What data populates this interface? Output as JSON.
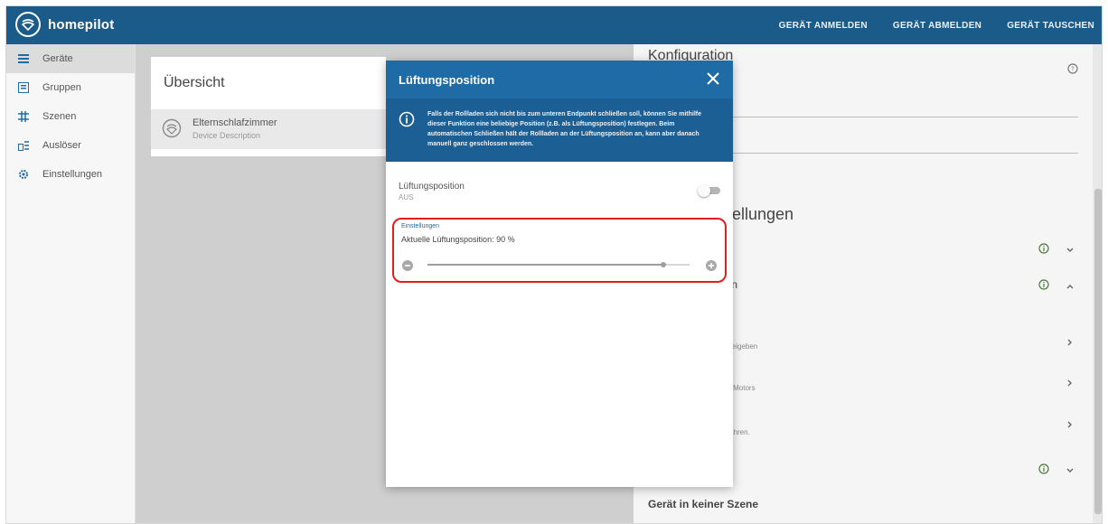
{
  "app": {
    "name": "homepilot"
  },
  "header": {
    "actions": [
      "GERÄT ANMELDEN",
      "GERÄT ABMELDEN",
      "GERÄT TAUSCHEN"
    ]
  },
  "sidebar": {
    "items": [
      {
        "label": "Geräte",
        "icon": "list-icon",
        "active": true
      },
      {
        "label": "Gruppen",
        "icon": "group-icon"
      },
      {
        "label": "Szenen",
        "icon": "scene-icon"
      },
      {
        "label": "Auslöser",
        "icon": "trigger-icon"
      },
      {
        "label": "Einstellungen",
        "icon": "gear-icon"
      }
    ]
  },
  "overview": {
    "title": "Übersicht",
    "device": {
      "name": "Elternschlafzimmer",
      "description": "Device Description"
    }
  },
  "config": {
    "title": "Konfiguration",
    "einstellungen_title": "stellungen",
    "rows": [
      {
        "label": "gen"
      },
      {
        "small": "nt freigeben"
      },
      {
        "label": "r",
        "small": "des Motors"
      },
      {
        "small": "anfahren."
      }
    ],
    "scene_text": "Gerät in keiner Szene"
  },
  "modal": {
    "title": "Lüftungsposition",
    "info_text": "Falls der Rollladen sich nicht bis zum unteren Endpunkt schließen soll, können Sie mithilfe dieser Funktion eine beliebige Position (z.B. als Lüftungsposition) festlegen. Beim automatischen Schließen hält der Rollladen an der Lüftungsposition an, kann aber danach manuell ganz geschlossen werden.",
    "toggle_label": "Lüftungsposition",
    "toggle_status": "AUS",
    "settings_label": "Einstellungen",
    "current_position": "Aktuelle Lüftungsposition: 90 %",
    "slider_value": 90
  },
  "colors": {
    "primary": "#1b5b8a",
    "modal_header": "#1e6ba5",
    "highlight": "#e01e1e"
  }
}
